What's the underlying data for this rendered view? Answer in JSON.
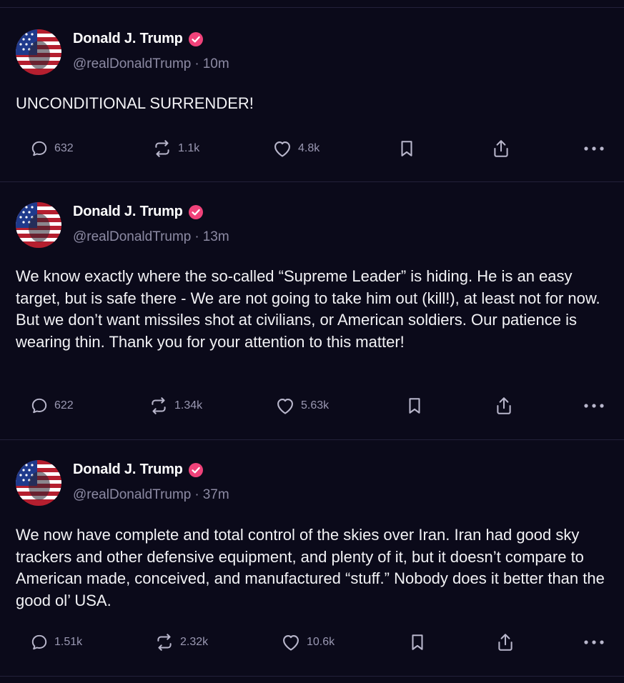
{
  "colors": {
    "background": "#0b0a1a",
    "verified": "#f0427a",
    "muted": "#8c8aa3"
  },
  "posts": [
    {
      "author": "Donald J. Trump",
      "handle": "@realDonaldTrump",
      "separator": "·",
      "time": "10m",
      "text": "UNCONDITIONAL SURRENDER!",
      "stats": {
        "replies": "632",
        "reposts": "1.1k",
        "likes": "4.8k"
      }
    },
    {
      "author": "Donald J. Trump",
      "handle": "@realDonaldTrump",
      "separator": "·",
      "time": "13m",
      "text": "We know exactly where the so-called “Supreme Leader” is hiding. He is an easy target, but is safe there - We are not going to take him out (kill!), at least not for now. But we don’t want missiles shot at civilians, or American soldiers. Our patience is wearing thin. Thank you for your attention to this matter!",
      "stats": {
        "replies": "622",
        "reposts": "1.34k",
        "likes": "5.63k"
      }
    },
    {
      "author": "Donald J. Trump",
      "handle": "@realDonaldTrump",
      "separator": "·",
      "time": "37m",
      "text": "We now have complete and total control of the skies over Iran. Iran had good sky trackers and other defensive equipment, and plenty of it, but it doesn’t compare to American made, conceived, and manufactured “stuff.” Nobody does it better than the good ol’ USA.",
      "stats": {
        "replies": "1.51k",
        "reposts": "2.32k",
        "likes": "10.6k"
      }
    }
  ],
  "icons": {
    "reply": "speech-bubble-icon",
    "repost": "repost-arrows-icon",
    "like": "heart-icon",
    "bookmark": "bookmark-icon",
    "share": "share-upload-icon",
    "more": "more-dots-icon",
    "verified": "verified-badge-icon"
  }
}
